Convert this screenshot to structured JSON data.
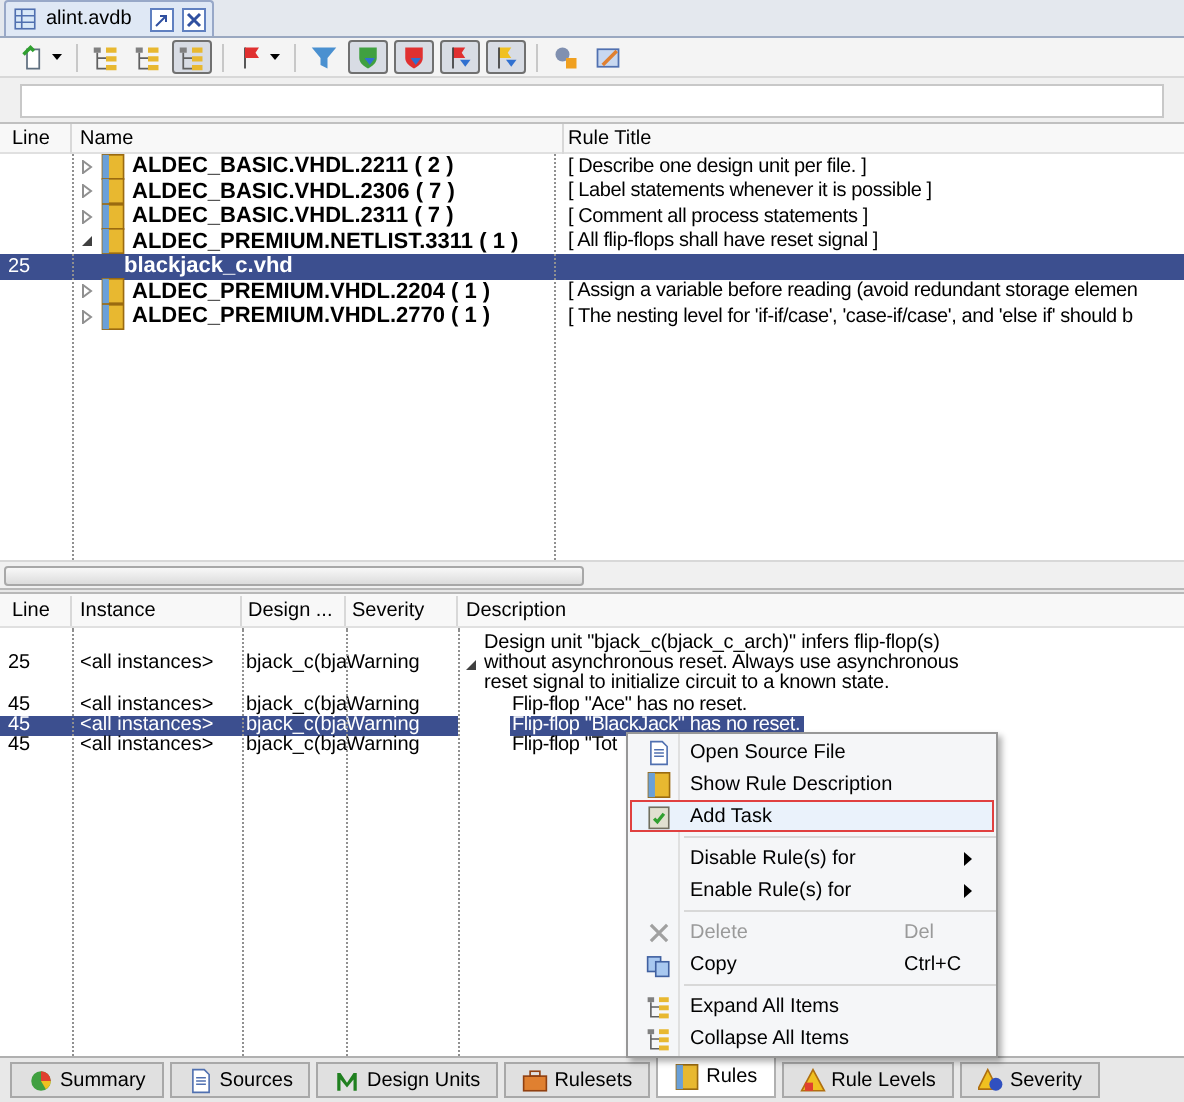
{
  "document_tab": {
    "title": "alint.avdb"
  },
  "rules": {
    "columns": [
      "Line",
      "Name",
      "Rule Title"
    ],
    "rows": [
      {
        "name": "ALDEC_BASIC.VHDL.2211 ( 2 )",
        "title": "[ Describe one design unit per file. ]",
        "expanded": false
      },
      {
        "name": "ALDEC_BASIC.VHDL.2306 ( 7 )",
        "title": "[ Label statements  whenever it is possible ]",
        "expanded": false
      },
      {
        "name": "ALDEC_BASIC.VHDL.2311 ( 7 )",
        "title": "[ Comment all process statements ]",
        "expanded": false
      },
      {
        "name": "ALDEC_PREMIUM.NETLIST.3311 ( 1 )",
        "title": "[ All flip-flops shall have reset signal ]",
        "expanded": true,
        "children": [
          {
            "line": "25",
            "name": "blackjack_c.vhd",
            "selected": true
          }
        ]
      },
      {
        "name": "ALDEC_PREMIUM.VHDL.2204 ( 1 )",
        "title": "[ Assign a variable before reading (avoid redundant storage elemen",
        "expanded": false
      },
      {
        "name": "ALDEC_PREMIUM.VHDL.2770 ( 1 )",
        "title": "[ The nesting level for 'if-if/case', 'case-if/case', and 'else if' should b",
        "expanded": false
      }
    ]
  },
  "messages": {
    "columns": [
      "Line",
      "Instance",
      "Design ...",
      "Severity",
      "Description"
    ],
    "rows": [
      {
        "line": "25",
        "instance": "<all instances>",
        "design_unit": "bjack_c(bja",
        "severity": "Warning",
        "description": "Design unit \"bjack_c(bjack_c_arch)\" infers flip-flop(s) without asynchronous reset. Always use asynchronous reset signal to initialize circuit to a known state.",
        "selected": false,
        "expanded": true,
        "children": [
          {
            "line": "45",
            "instance": "<all instances>",
            "design_unit": "bjack_c(bja",
            "severity": "Warning",
            "description": "Flip-flop \"Ace\" has no reset.",
            "selected": false
          },
          {
            "line": "45",
            "instance": "<all instances>",
            "design_unit": "bjack_c(bja",
            "severity": "Warning",
            "description": "Flip-flop \"BlackJack\" has no reset.",
            "selected": true
          },
          {
            "line": "45",
            "instance": "<all instances>",
            "design_unit": "bjack_c(bja",
            "severity": "Warning",
            "description": "Flip-flop \"Tot",
            "selected": false
          }
        ]
      }
    ]
  },
  "context_menu": [
    {
      "kind": "item",
      "label": "Open Source File",
      "selected": false,
      "disabled": false
    },
    {
      "kind": "item",
      "label": "Show Rule Description",
      "selected": false,
      "disabled": false
    },
    {
      "kind": "item",
      "label": "Add Task",
      "selected": true,
      "disabled": false
    },
    {
      "kind": "separator"
    },
    {
      "kind": "submenu",
      "label": "Disable Rule(s) for",
      "selected": false,
      "disabled": false
    },
    {
      "kind": "submenu",
      "label": "Enable Rule(s) for",
      "selected": false,
      "disabled": false
    },
    {
      "kind": "separator"
    },
    {
      "kind": "item",
      "label": "Delete",
      "shortcut": "Del",
      "selected": false,
      "disabled": true
    },
    {
      "kind": "item",
      "label": "Copy",
      "shortcut": "Ctrl+C",
      "selected": false,
      "disabled": false
    },
    {
      "kind": "separator"
    },
    {
      "kind": "item",
      "label": "Expand All Items",
      "selected": false,
      "disabled": false
    },
    {
      "kind": "item",
      "label": "Collapse All Items",
      "selected": false,
      "disabled": false
    }
  ],
  "bottom_tabs": [
    {
      "label": "Summary",
      "selected": false
    },
    {
      "label": "Sources",
      "selected": false
    },
    {
      "label": "Design Units",
      "selected": false
    },
    {
      "label": "Rulesets",
      "selected": false
    },
    {
      "label": "Rules",
      "selected": true
    },
    {
      "label": "Rule Levels",
      "selected": false
    },
    {
      "label": "Severity",
      "selected": false
    }
  ]
}
